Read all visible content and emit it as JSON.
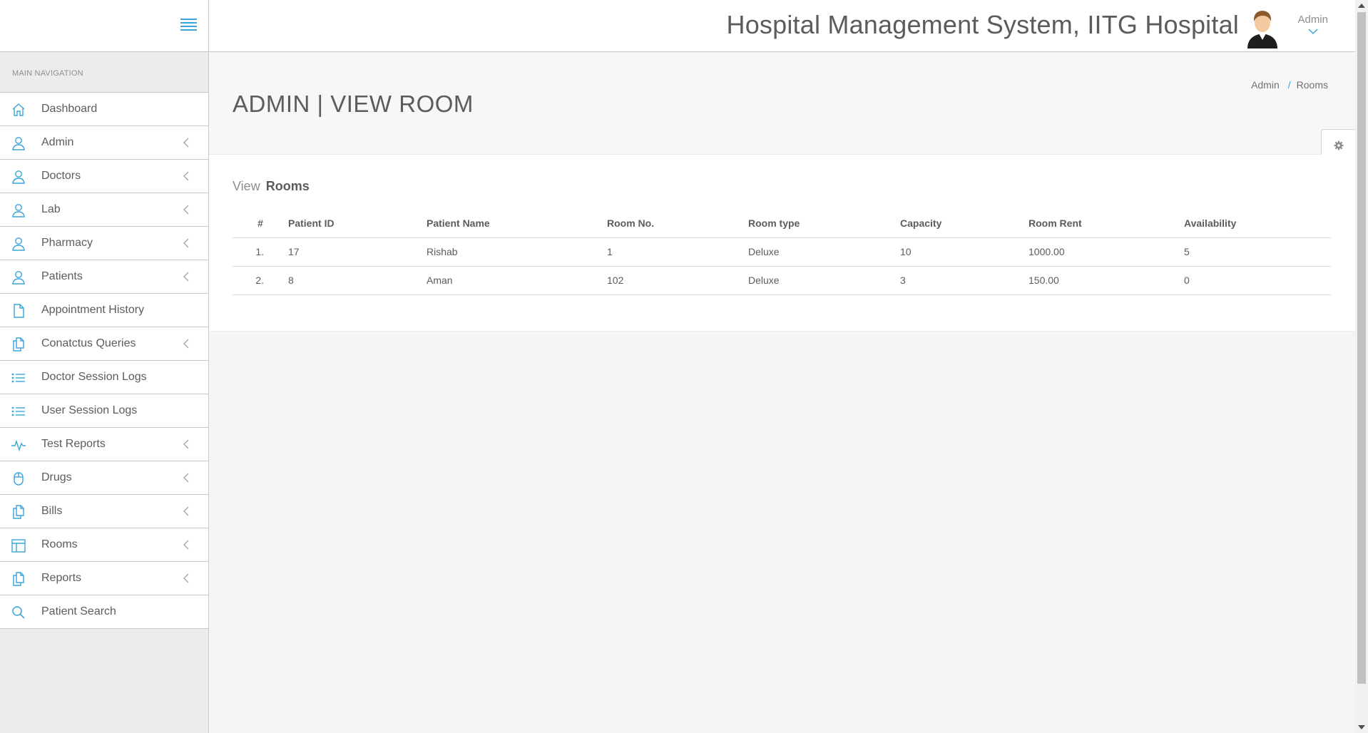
{
  "header": {
    "title": "Hospital Management System, IITG Hospital",
    "user_name": "Admin"
  },
  "sidebar": {
    "heading": "MAIN NAVIGATION",
    "items": [
      {
        "label": "Dashboard",
        "icon": "home-icon",
        "has_submenu": false
      },
      {
        "label": "Admin",
        "icon": "user-icon",
        "has_submenu": true
      },
      {
        "label": "Doctors",
        "icon": "user-icon",
        "has_submenu": true
      },
      {
        "label": "Lab",
        "icon": "user-icon",
        "has_submenu": true
      },
      {
        "label": "Pharmacy",
        "icon": "user-icon",
        "has_submenu": true
      },
      {
        "label": "Patients",
        "icon": "user-icon",
        "has_submenu": true
      },
      {
        "label": "Appointment History",
        "icon": "file-icon",
        "has_submenu": false
      },
      {
        "label": "Conatctus Queries",
        "icon": "files-icon",
        "has_submenu": true
      },
      {
        "label": "Doctor Session Logs",
        "icon": "list-icon",
        "has_submenu": false
      },
      {
        "label": "User Session Logs",
        "icon": "list-icon",
        "has_submenu": false
      },
      {
        "label": "Test Reports",
        "icon": "pulse-icon",
        "has_submenu": true
      },
      {
        "label": "Drugs",
        "icon": "mouse-icon",
        "has_submenu": true
      },
      {
        "label": "Bills",
        "icon": "files-icon",
        "has_submenu": true
      },
      {
        "label": "Rooms",
        "icon": "layout-icon",
        "has_submenu": true
      },
      {
        "label": "Reports",
        "icon": "files-icon",
        "has_submenu": true
      },
      {
        "label": "Patient Search",
        "icon": "search-icon",
        "has_submenu": false
      }
    ]
  },
  "page": {
    "title": "ADMIN | VIEW ROOM",
    "breadcrumb": [
      "Admin",
      "Rooms"
    ],
    "section_prefix": "View",
    "section_title": "Rooms"
  },
  "table": {
    "columns": [
      "#",
      "Patient ID",
      "Patient Name",
      "Room No.",
      "Room type",
      "Capacity",
      "Room Rent",
      "Availability"
    ],
    "rows": [
      [
        "1.",
        "17",
        "Rishab",
        "1",
        "Deluxe",
        "10",
        "1000.00",
        "5"
      ],
      [
        "2.",
        "8",
        "Aman",
        "102",
        "Deluxe",
        "3",
        "150.00",
        "0"
      ]
    ]
  },
  "colors": {
    "accent": "#3aa4d9",
    "text": "#5b5b60",
    "sidebar_bg": "#ececec"
  }
}
